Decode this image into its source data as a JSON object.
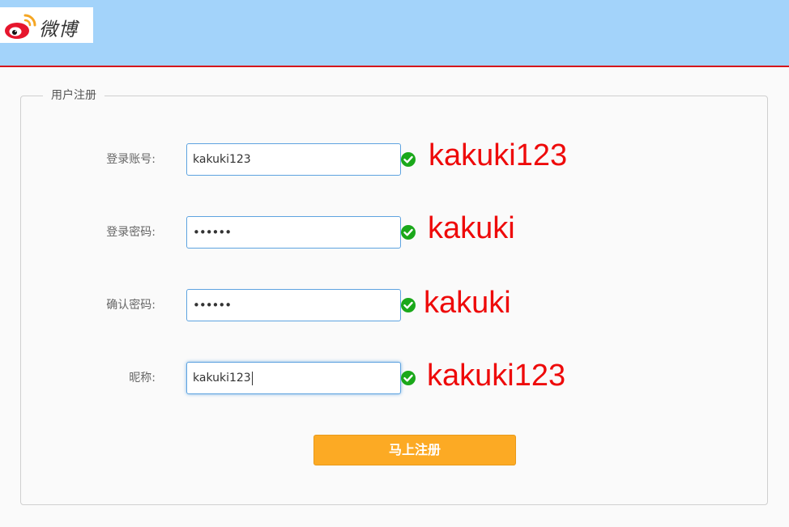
{
  "header": {
    "logo_text": "微博",
    "colors": {
      "background": "#a3d3fa",
      "border": "#d4161c"
    }
  },
  "form": {
    "legend": "用户注册",
    "fields": [
      {
        "label": "登录账号:",
        "value": "kakuki123",
        "note": "kakuki123",
        "valid": true
      },
      {
        "label": "登录密码:",
        "value": "••••••",
        "note": "kakuki",
        "valid": true
      },
      {
        "label": "确认密码:",
        "value": "••••••",
        "note": "kakuki",
        "valid": true
      },
      {
        "label": "昵称:",
        "value": "kakuki123",
        "note": "kakuki123",
        "valid": true,
        "focused": true
      }
    ],
    "submit_label": "马上注册",
    "icons": {
      "valid": "check-circle-icon",
      "logo": "weibo-logo-icon"
    },
    "colors": {
      "submit": "#fcaa24",
      "valid": "#1aa81a",
      "note": "#ee0a0a",
      "field_border": "#5ea3e0"
    }
  }
}
